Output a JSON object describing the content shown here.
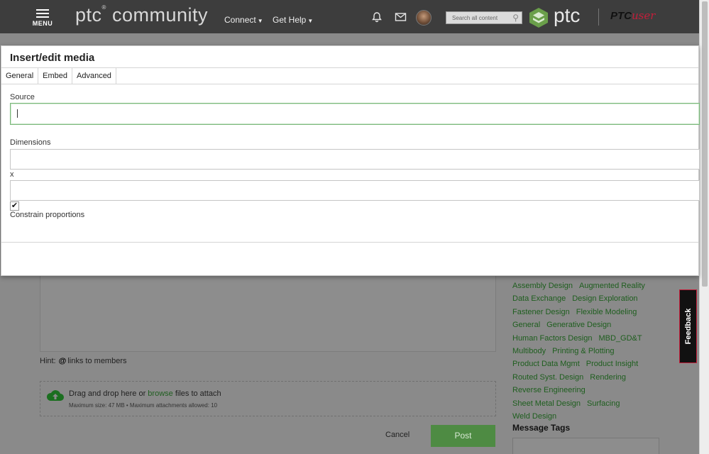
{
  "header": {
    "menu_label": "MENU",
    "logo_text": "ptc",
    "logo_sup": "®",
    "logo_text2": "community",
    "nav": [
      {
        "label": "Connect"
      },
      {
        "label": "Get Help"
      }
    ],
    "search_placeholder": "Search all content",
    "brand_text": "ptc",
    "ptcuser_a": "PTC",
    "ptcuser_b": "user"
  },
  "modal": {
    "title": "Insert/edit media",
    "tabs": [
      {
        "label": "General",
        "active": true
      },
      {
        "label": "Embed"
      },
      {
        "label": "Advanced"
      }
    ],
    "source_label": "Source",
    "source_value": "",
    "dimensions_label": "Dimensions",
    "width_value": "",
    "x_label": "x",
    "height_value": "",
    "constrain_label": "Constrain proportions",
    "constrain_checked": true
  },
  "page": {
    "hint_label": "Hint:",
    "hint_at": "@",
    "hint_text": "links to members",
    "dropzone_text_a": "Drag and drop here or",
    "dropzone_link": "browse",
    "dropzone_text_b": "files to attach",
    "dropzone_limits": "Maximum size: 47 MB • Maximum attachments allowed: 10",
    "cancel_label": "Cancel",
    "post_label": "Post",
    "labels": [
      "Assembly Design",
      "Augmented Reality",
      "Data Exchange",
      "Design Exploration",
      "Fastener Design",
      "Flexible Modeling",
      "General",
      "Generative Design",
      "Human Factors Design",
      "MBD_GD&T",
      "Multibody",
      "Printing & Plotting",
      "Product Data Mgmt",
      "Product Insight",
      "Routed Syst. Design",
      "Rendering",
      "Reverse Engineering",
      "Sheet Metal Design",
      "Surfacing",
      "Weld Design"
    ],
    "message_tags_title": "Message Tags",
    "feedback_label": "Feedback"
  },
  "colors": {
    "brand_green": "#4e8b43",
    "link_green": "#1e5e1e",
    "header_bg": "#3d3d3d",
    "ptcuser_red": "#c41e3a"
  }
}
